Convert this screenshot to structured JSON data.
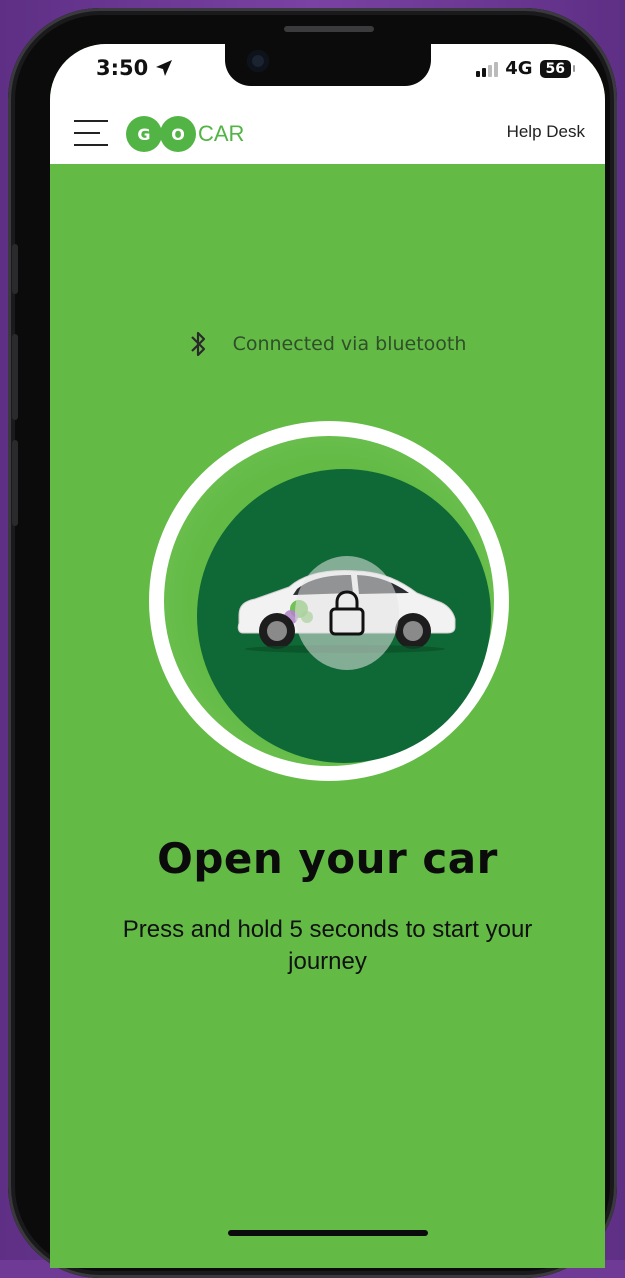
{
  "status_bar": {
    "time": "3:50",
    "network": "4G",
    "battery": "56",
    "signal_bars": 2
  },
  "header": {
    "logo_letters": [
      "G",
      "O"
    ],
    "logo_suffix": "CAR",
    "help_label": "Help Desk"
  },
  "connection": {
    "text": "Connected via bluetooth",
    "icon": "bluetooth-icon"
  },
  "unlock_button": {
    "icon": "lock-icon"
  },
  "main": {
    "title": "Open your car",
    "subtitle": "Press and hold 5 seconds to start your journey"
  },
  "colors": {
    "background_green": "#63bb46",
    "circle_dark_green": "#0f6936",
    "brand_green": "#52b445",
    "frame_purple": "#6f3a96"
  }
}
